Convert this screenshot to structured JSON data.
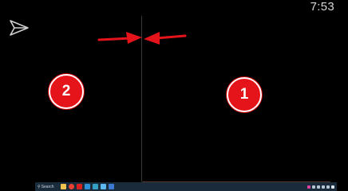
{
  "status_bar": {
    "time": "7:53"
  },
  "annotations": {
    "badge_left": "2",
    "badge_right": "1"
  },
  "taskbar": {
    "search_label": "Search",
    "apps": [
      {
        "name": "file-explorer-icon",
        "color": "#f2c14e"
      },
      {
        "name": "chrome-icon",
        "color": "#e94235"
      },
      {
        "name": "app-red-icon",
        "color": "#d62020"
      },
      {
        "name": "app-blue-icon",
        "color": "#2f8fd8"
      },
      {
        "name": "app-teal-icon",
        "color": "#34a0c4"
      },
      {
        "name": "app-light-blue-icon",
        "color": "#5bb8f0"
      },
      {
        "name": "app-blue2-icon",
        "color": "#3b78d0"
      }
    ]
  },
  "colors": {
    "accent_red": "#e4141a",
    "background": "#000000"
  }
}
